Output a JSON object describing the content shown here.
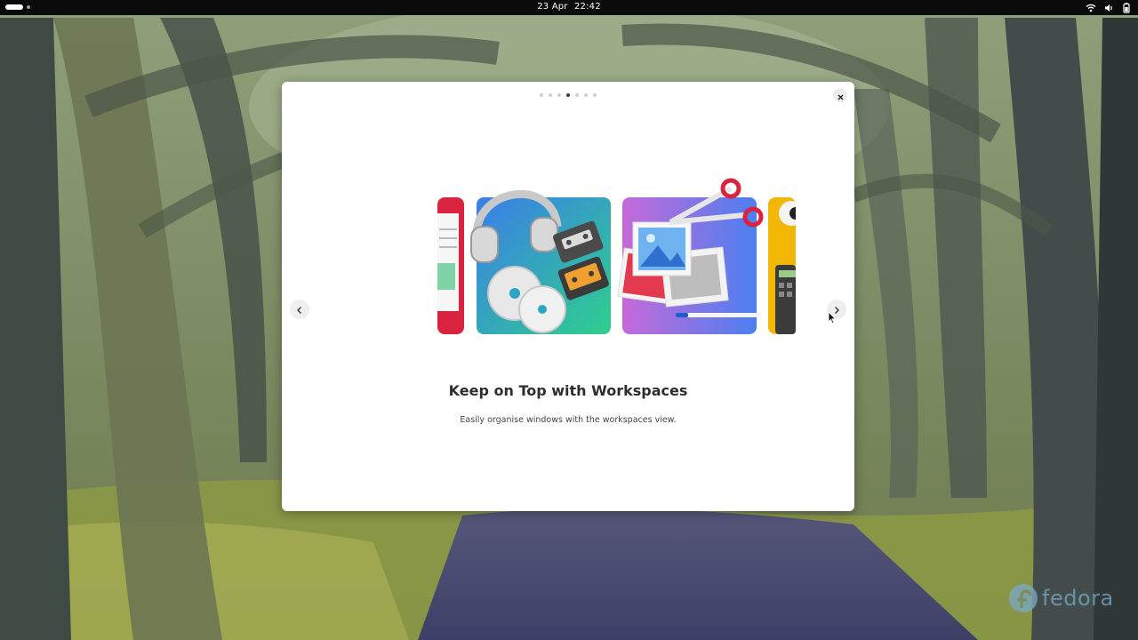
{
  "topbar": {
    "date": "23 Apr",
    "time": "22:42"
  },
  "dialog": {
    "pages": {
      "total": 7,
      "current": 4
    },
    "title": "Keep on Top with Workspaces",
    "description": "Easily organise windows with the workspaces view."
  },
  "branding": {
    "text": "fedora"
  },
  "colors": {
    "accent_red": "#d9233f",
    "accent_teal": "#2fc79a",
    "accent_blue": "#3d7ee6",
    "accent_purple": "#b46be0",
    "accent_yellow": "#f2b705"
  },
  "icons": [
    "network-icon",
    "volume-icon",
    "power-icon",
    "close-icon",
    "chevron-left-icon",
    "chevron-right-icon",
    "fedora-logo-icon"
  ]
}
